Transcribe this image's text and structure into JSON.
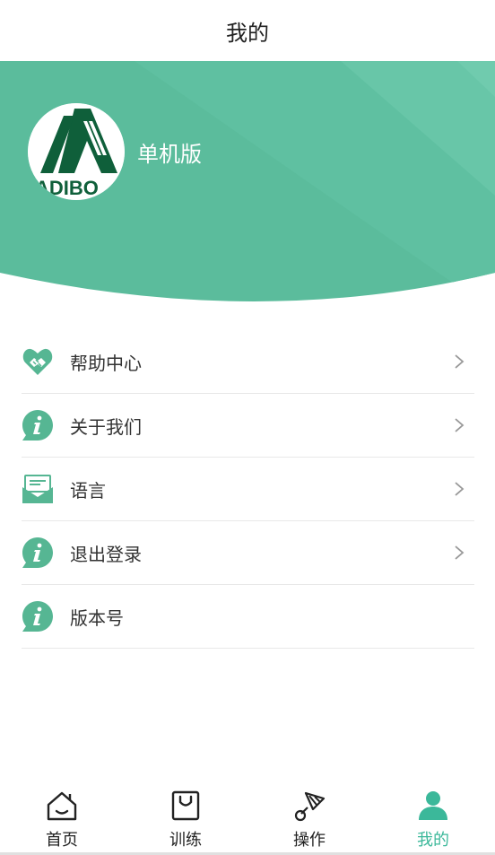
{
  "header": {
    "title": "我的"
  },
  "profile": {
    "name": "单机版",
    "logo_text": "ADIBO"
  },
  "colors": {
    "accent": "#3bb89a",
    "hero": "#5dbd9e",
    "hero_light": "#73ccb0",
    "icon": "#56b693"
  },
  "menu": {
    "items": [
      {
        "icon": "handshake-heart-icon",
        "label": "帮助中心",
        "chevron": true
      },
      {
        "icon": "info-bubble-icon",
        "label": "关于我们",
        "chevron": true
      },
      {
        "icon": "envelope-message-icon",
        "label": "语言",
        "chevron": true
      },
      {
        "icon": "info-bubble-icon",
        "label": "退出登录",
        "chevron": true
      },
      {
        "icon": "info-bubble-icon",
        "label": "版本号",
        "chevron": false
      }
    ]
  },
  "tabbar": {
    "items": [
      {
        "icon": "home-icon",
        "label": "首页",
        "active": false
      },
      {
        "icon": "bag-icon",
        "label": "训练",
        "active": false
      },
      {
        "icon": "shuttlecock-icon",
        "label": "操作",
        "active": false
      },
      {
        "icon": "user-icon",
        "label": "我的",
        "active": true
      }
    ]
  }
}
